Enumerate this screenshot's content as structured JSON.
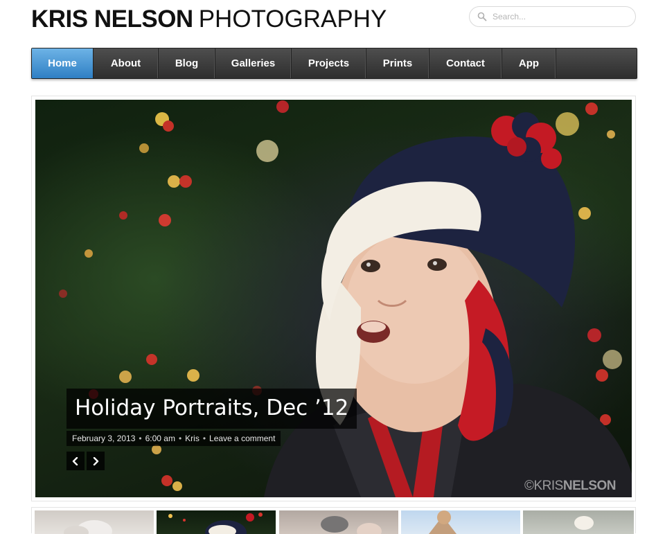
{
  "site": {
    "title_bold": "KRIS NELSON",
    "title_light": "PHOTOGRAPHY"
  },
  "search": {
    "placeholder": "Search...",
    "value": ""
  },
  "nav": {
    "items": [
      {
        "label": "Home",
        "active": true
      },
      {
        "label": "About"
      },
      {
        "label": "Blog"
      },
      {
        "label": "Galleries"
      },
      {
        "label": "Projects"
      },
      {
        "label": "Prints"
      },
      {
        "label": "Contact"
      },
      {
        "label": "App"
      }
    ]
  },
  "slide": {
    "title": "Holiday Portraits, Dec ’12",
    "date": "February 3, 2013",
    "time": "6:00 am",
    "author": "Kris",
    "comment_link": "Leave a comment",
    "separator": "•",
    "watermark_prefix": "©KRIS",
    "watermark_suffix": "NELSON"
  },
  "thumbnails": {
    "count": 5,
    "active_index": 1
  },
  "colors": {
    "nav_active": "#3f8fd2",
    "nav_bg": "#3a3a3a",
    "accent_red": "#c4161c",
    "hat_navy": "#1d2340"
  }
}
